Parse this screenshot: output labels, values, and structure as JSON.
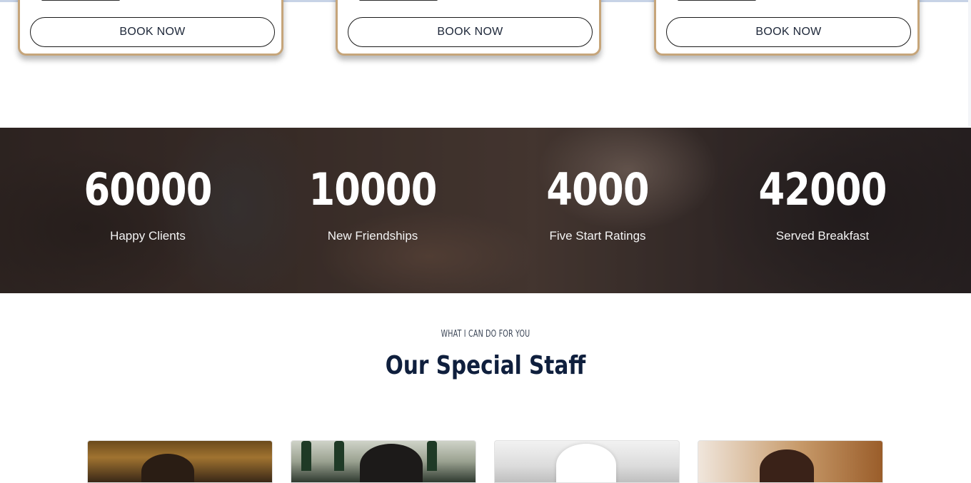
{
  "cards": [
    {
      "button_label": "BOOK NOW"
    },
    {
      "button_label": "BOOK NOW"
    },
    {
      "button_label": "BOOK NOW"
    }
  ],
  "stats": [
    {
      "value": "60000",
      "label": "Happy Clients"
    },
    {
      "value": "10000",
      "label": "New Friendships"
    },
    {
      "value": "4000",
      "label": "Five Start Ratings"
    },
    {
      "value": "42000",
      "label": "Served Breakfast"
    }
  ],
  "staff_section": {
    "eyebrow": "WHAT I CAN DO FOR YOU",
    "title": "Our Special Staff",
    "members": [
      {
        "photo": "staff-photo-1"
      },
      {
        "photo": "staff-photo-2"
      },
      {
        "photo": "staff-photo-3"
      },
      {
        "photo": "staff-photo-4"
      }
    ]
  },
  "colors": {
    "card_border": "#c6a57a",
    "title": "#0f1f3d",
    "stat_text": "#ffffff"
  }
}
